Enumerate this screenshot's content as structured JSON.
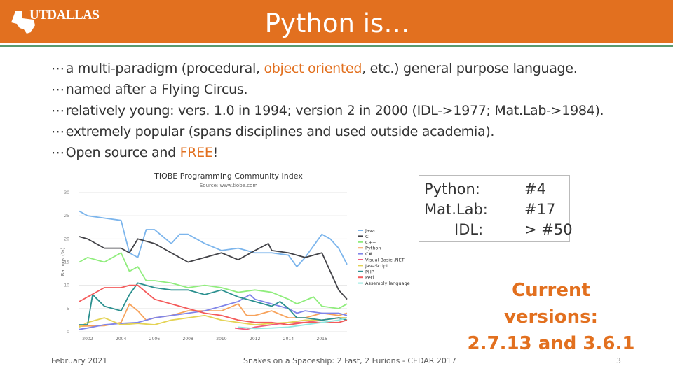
{
  "header": {
    "logo_text": "UTDALLAS",
    "title": "Python is…",
    "bar_color": "#e2701f"
  },
  "bullets": [
    {
      "marker": "⋯",
      "before": "a multi-paradigm (procedural, ",
      "highlight": "object oriented",
      "after": ", etc.) general purpose language."
    },
    {
      "marker": "⋯",
      "before": "named after a Flying Circus.",
      "highlight": "",
      "after": ""
    },
    {
      "marker": "⋯",
      "before": "relatively young: vers. 1.0 in 1994; version 2 in 2000 (IDL->1977; Mat.Lab->1984).",
      "highlight": "",
      "after": ""
    },
    {
      "marker": "⋯",
      "before": "extremely popular (spans disciplines and used outside academia).",
      "highlight": "",
      "after": ""
    },
    {
      "marker": "⋯",
      "before": "Open source and ",
      "highlight": "FREE",
      "after": "!"
    }
  ],
  "ranking": {
    "rows": [
      {
        "lang": "Python:",
        "rank": "#4"
      },
      {
        "lang": "Mat.Lab:",
        "rank": "#17"
      },
      {
        "lang": "IDL:",
        "rank": "> #50"
      }
    ]
  },
  "versions": {
    "line1": "Current versions:",
    "line2": "2.7.13 and 3.6.1"
  },
  "footer": {
    "date": "February 2021",
    "center": "Snakes on a Spaceship: 2 Fast, 2 Furions - CEDAR 2017",
    "page": "3"
  },
  "chart_data": {
    "type": "line",
    "title": "TIOBE Programming Community Index",
    "subtitle": "Source: www.tiobe.com",
    "ylabel": "Ratings (%)",
    "xlabel": "",
    "ylim": [
      0,
      30
    ],
    "xlim": [
      2001.5,
      2017.5
    ],
    "yticks": [
      "0",
      "5",
      "10",
      "15",
      "20",
      "25",
      "30"
    ],
    "xticks": [
      "2002",
      "2004",
      "2006",
      "2008",
      "2010",
      "2012",
      "2014",
      "2016"
    ],
    "grid": true,
    "legend": "right",
    "series": [
      {
        "name": "Java",
        "color": "#7cb5ec",
        "points": [
          [
            2001.5,
            26
          ],
          [
            2002,
            25
          ],
          [
            2003,
            24.5
          ],
          [
            2004,
            24
          ],
          [
            2004.5,
            17
          ],
          [
            2005,
            16
          ],
          [
            2005.5,
            22
          ],
          [
            2006,
            22
          ],
          [
            2007,
            19
          ],
          [
            2007.5,
            21
          ],
          [
            2008,
            21
          ],
          [
            2009,
            19
          ],
          [
            2010,
            17.5
          ],
          [
            2011,
            18
          ],
          [
            2012,
            17
          ],
          [
            2013,
            17
          ],
          [
            2014,
            16.5
          ],
          [
            2014.5,
            14
          ],
          [
            2015,
            16
          ],
          [
            2016,
            21
          ],
          [
            2016.5,
            20
          ],
          [
            2017,
            18
          ],
          [
            2017.5,
            14.5
          ]
        ]
      },
      {
        "name": "C",
        "color": "#434348",
        "points": [
          [
            2001.5,
            20.5
          ],
          [
            2002,
            20
          ],
          [
            2003,
            18
          ],
          [
            2004,
            18
          ],
          [
            2004.5,
            17
          ],
          [
            2005,
            20
          ],
          [
            2006,
            19
          ],
          [
            2007,
            17
          ],
          [
            2008,
            15
          ],
          [
            2009,
            16
          ],
          [
            2010,
            17
          ],
          [
            2011,
            15.5
          ],
          [
            2012,
            17.5
          ],
          [
            2012.8,
            19
          ],
          [
            2013,
            17.5
          ],
          [
            2014,
            17
          ],
          [
            2015,
            16
          ],
          [
            2016,
            17
          ],
          [
            2016.5,
            13
          ],
          [
            2017,
            9
          ],
          [
            2017.5,
            7
          ]
        ]
      },
      {
        "name": "C++",
        "color": "#90ed7d",
        "points": [
          [
            2001.5,
            15
          ],
          [
            2002,
            16
          ],
          [
            2003,
            15
          ],
          [
            2004,
            17
          ],
          [
            2004.5,
            13
          ],
          [
            2005,
            14
          ],
          [
            2005.5,
            11
          ],
          [
            2006,
            11
          ],
          [
            2007,
            10.5
          ],
          [
            2008,
            9.5
          ],
          [
            2009,
            10
          ],
          [
            2010,
            9.5
          ],
          [
            2011,
            8.5
          ],
          [
            2012,
            9
          ],
          [
            2013,
            8.5
          ],
          [
            2014,
            7
          ],
          [
            2014.5,
            6
          ],
          [
            2015.5,
            7.5
          ],
          [
            2016,
            5.5
          ],
          [
            2017,
            5
          ],
          [
            2017.5,
            6
          ]
        ]
      },
      {
        "name": "Python",
        "color": "#f7a35c",
        "points": [
          [
            2001.5,
            1.2
          ],
          [
            2003,
            1.3
          ],
          [
            2004,
            2
          ],
          [
            2004.5,
            6
          ],
          [
            2005,
            4.5
          ],
          [
            2005.5,
            2.5
          ],
          [
            2006,
            3
          ],
          [
            2007,
            3.5
          ],
          [
            2008,
            4.5
          ],
          [
            2009,
            4.5
          ],
          [
            2010,
            4.5
          ],
          [
            2011,
            6
          ],
          [
            2011.5,
            3.5
          ],
          [
            2012,
            3.5
          ],
          [
            2013,
            4.5
          ],
          [
            2014,
            3
          ],
          [
            2015,
            3
          ],
          [
            2016,
            4
          ],
          [
            2017,
            3.5
          ],
          [
            2017.5,
            4
          ]
        ]
      },
      {
        "name": "C#",
        "color": "#8085e9",
        "points": [
          [
            2001.5,
            0.5
          ],
          [
            2002,
            0.8
          ],
          [
            2003,
            1.5
          ],
          [
            2004,
            1.8
          ],
          [
            2005,
            2
          ],
          [
            2006,
            3
          ],
          [
            2007,
            3.5
          ],
          [
            2008,
            4
          ],
          [
            2009,
            4.5
          ],
          [
            2010,
            5.5
          ],
          [
            2011,
            6.5
          ],
          [
            2011.7,
            8
          ],
          [
            2012,
            7
          ],
          [
            2013,
            6
          ],
          [
            2014,
            5
          ],
          [
            2014.5,
            4
          ],
          [
            2015,
            4.5
          ],
          [
            2016,
            4
          ],
          [
            2017,
            4
          ],
          [
            2017.5,
            3.5
          ]
        ]
      },
      {
        "name": "Visual Basic .NET",
        "color": "#f15c80",
        "points": [
          [
            2010.8,
            0.8
          ],
          [
            2011.5,
            0.5
          ],
          [
            2012,
            1
          ],
          [
            2013,
            1.5
          ],
          [
            2014,
            2
          ],
          [
            2015,
            2
          ],
          [
            2016,
            2.5
          ],
          [
            2017,
            3
          ],
          [
            2017.5,
            3
          ]
        ]
      },
      {
        "name": "JavaScript",
        "color": "#e4d354",
        "points": [
          [
            2001.5,
            1
          ],
          [
            2002,
            2
          ],
          [
            2003,
            3
          ],
          [
            2004,
            1.5
          ],
          [
            2005,
            1.8
          ],
          [
            2006,
            1.5
          ],
          [
            2007,
            2.5
          ],
          [
            2008,
            3
          ],
          [
            2009,
            3.5
          ],
          [
            2010,
            2.5
          ],
          [
            2011,
            2
          ],
          [
            2012,
            1.5
          ],
          [
            2013,
            1.8
          ],
          [
            2014,
            2
          ],
          [
            2015,
            2.5
          ],
          [
            2016,
            2.5
          ],
          [
            2017,
            3
          ],
          [
            2017.5,
            3
          ]
        ]
      },
      {
        "name": "PHP",
        "color": "#2b908f",
        "points": [
          [
            2001.5,
            1.5
          ],
          [
            2002,
            1.5
          ],
          [
            2002.3,
            8
          ],
          [
            2003,
            5.5
          ],
          [
            2004,
            4.5
          ],
          [
            2004.5,
            8
          ],
          [
            2005,
            10.5
          ],
          [
            2006,
            9.5
          ],
          [
            2007,
            9
          ],
          [
            2008,
            9
          ],
          [
            2009,
            8
          ],
          [
            2010,
            9
          ],
          [
            2011,
            7.5
          ],
          [
            2012,
            6.5
          ],
          [
            2013,
            5.5
          ],
          [
            2013.5,
            6.5
          ],
          [
            2014,
            5
          ],
          [
            2014.5,
            3
          ],
          [
            2015,
            3
          ],
          [
            2016,
            2.5
          ],
          [
            2017,
            3
          ],
          [
            2017.5,
            2.5
          ]
        ]
      },
      {
        "name": "Perl",
        "color": "#f45b5b",
        "points": [
          [
            2001.5,
            6.5
          ],
          [
            2002,
            7.5
          ],
          [
            2003,
            9.5
          ],
          [
            2004,
            9.5
          ],
          [
            2004.5,
            10
          ],
          [
            2005,
            10
          ],
          [
            2006,
            7
          ],
          [
            2007,
            6
          ],
          [
            2008,
            5
          ],
          [
            2009,
            4
          ],
          [
            2010,
            3.5
          ],
          [
            2011,
            2.5
          ],
          [
            2012,
            2
          ],
          [
            2013,
            2
          ],
          [
            2014,
            1.5
          ],
          [
            2015,
            2
          ],
          [
            2016,
            2
          ],
          [
            2017,
            2
          ],
          [
            2017.5,
            2.5
          ]
        ]
      },
      {
        "name": "Assembly language",
        "color": "#91e8e1",
        "points": [
          [
            2011,
            1
          ],
          [
            2012,
            0.7
          ],
          [
            2013,
            0.8
          ],
          [
            2014,
            1
          ],
          [
            2015,
            1.5
          ],
          [
            2016,
            2
          ],
          [
            2017,
            2.5
          ],
          [
            2017.5,
            3
          ]
        ]
      }
    ]
  }
}
